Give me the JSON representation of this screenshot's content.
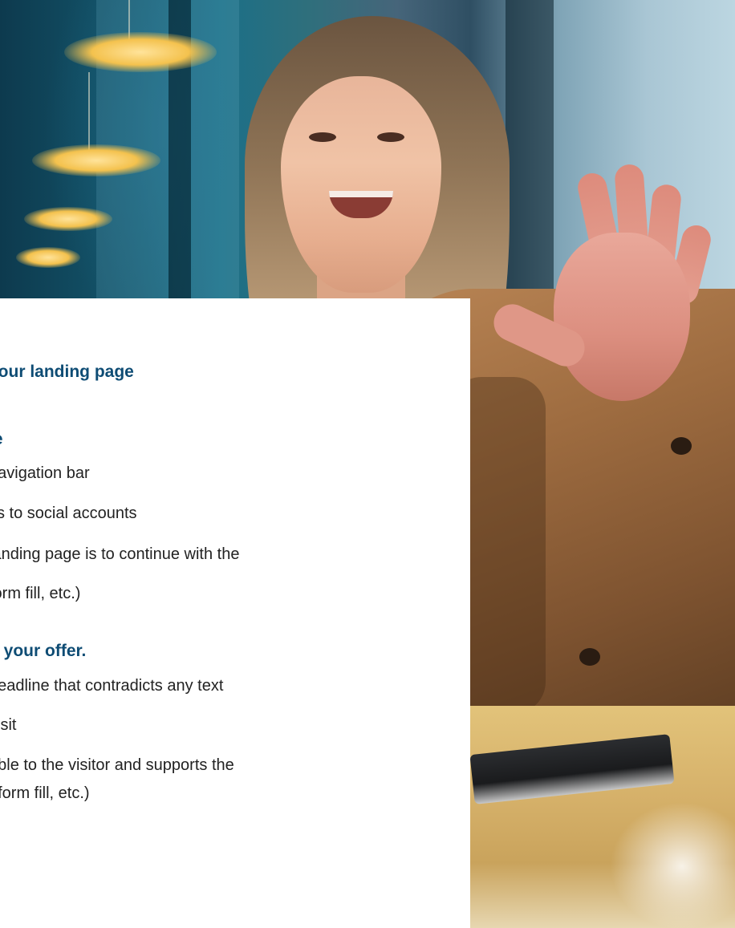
{
  "photo": {
    "alt_subject": "smiling woman raising her hand"
  },
  "colors": {
    "heading": "#0e4c74",
    "body_text": "#222222",
    "card_background": "#ffffff"
  },
  "card": {
    "section_title": "your landing page",
    "sections": [
      {
        "heading": "le",
        "lines": [
          "navigation bar",
          "ks to social accounts",
          "landing page is to continue with the",
          "form fill, etc.)"
        ]
      },
      {
        "heading": "d your offer.",
        "lines": [
          "headline that contradicts any text",
          "visit",
          "able to the visitor and supports the",
          ", form fill, etc.)"
        ]
      }
    ]
  }
}
